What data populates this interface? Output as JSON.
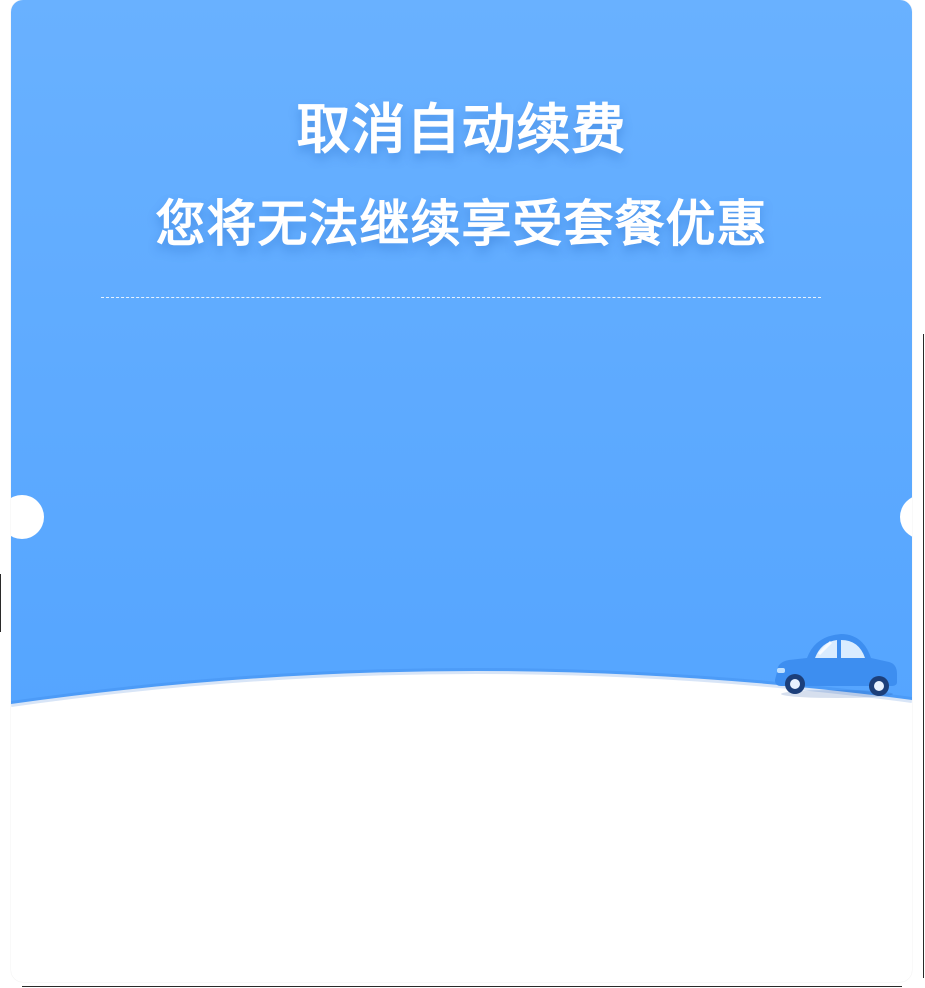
{
  "dialog": {
    "title": "取消自动续费",
    "subtitle": "您将无法继续享受套餐优惠"
  },
  "theme": {
    "hero_top": "#69b1ff",
    "hero_bottom": "#55a5ff",
    "car_body": "#3d8ef0",
    "car_window": "#d9ecff"
  },
  "icons": {
    "illustration": "car-icon"
  }
}
